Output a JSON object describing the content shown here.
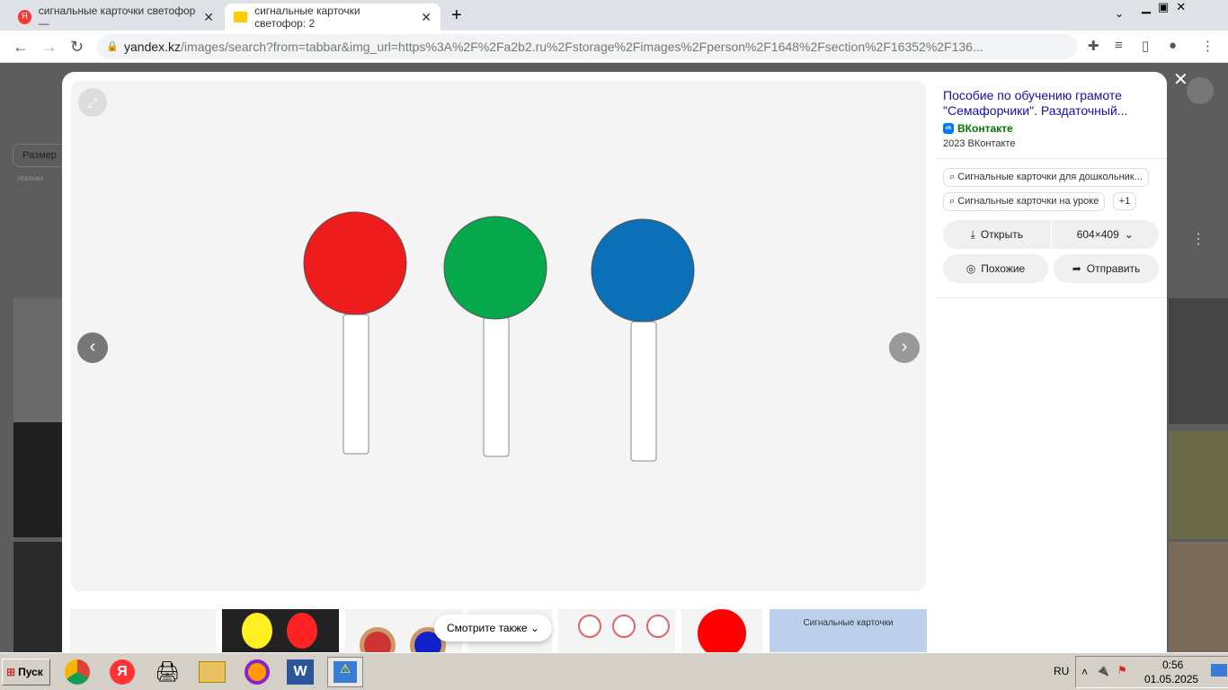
{
  "tabs": [
    {
      "label": "сигнальные карточки светофор —"
    },
    {
      "label": "сигнальные карточки светофор: 2"
    }
  ],
  "url": {
    "host": "yandex.kz",
    "path": "/images/search?from=tabbar&img_url=https%3A%2F%2Fa2b2.ru%2Fstorage%2Fimages%2Fperson%2F1648%2Fsection%2F16352%2F136..."
  },
  "background": {
    "size_filter": "Размер",
    "ad_label": "РЕКЛАМА"
  },
  "panel": {
    "title": "Пособие по обучению грамоте \"Семафорчики\". Раздаточный...",
    "source": "ВКонтакте",
    "meta": "2023 ВКонтакте",
    "related": [
      "Сигнальные карточки для дошкольник...",
      "Сигнальные карточки на уроке"
    ],
    "more": "+1",
    "open": "Открыть",
    "resolution": "604×409",
    "similar": "Похожие",
    "share": "Отправить"
  },
  "image": {
    "colors": [
      "#ee1c1c",
      "#05a84a",
      "#0a70b8"
    ]
  },
  "see_also": "Смотрите также",
  "thumb_caption": "Сигнальные карточки",
  "taskbar": {
    "start": "Пуск",
    "lang": "RU",
    "time": "0:56",
    "date": "01.05.2025"
  }
}
